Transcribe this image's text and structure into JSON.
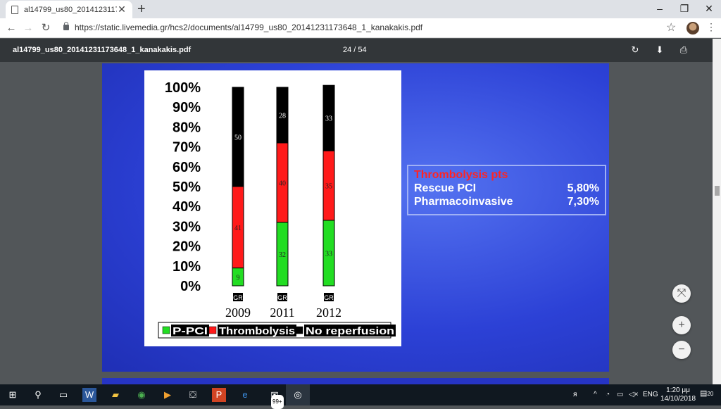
{
  "browser": {
    "tab_title": "al14799_us80_20141231173648_",
    "tab_close": "✕",
    "new_tab": "+",
    "minimize": "–",
    "restore": "❐",
    "close": "✕",
    "url": "https://static.livemedia.gr/hcs2/documents/al14799_us80_20141231173648_1_kanakakis.pdf"
  },
  "pdf": {
    "title": "al14799_us80_20141231173648_1_kanakakis.pdf",
    "page_indicator": "24 / 54"
  },
  "slide": {
    "info_title": "Thrombolysis pts",
    "rows": [
      {
        "label": "Rescue PCI",
        "value": "5,80%"
      },
      {
        "label": "Pharmacoinvasive",
        "value": "7,30%"
      }
    ]
  },
  "chart_data": {
    "type": "bar",
    "stacked": true,
    "categories": [
      "2009",
      "2011",
      "2012"
    ],
    "category_tags": [
      "GR",
      "GR",
      "GR"
    ],
    "series": [
      {
        "name": "P-PCI",
        "color": "#22dd22",
        "values": [
          9,
          32,
          33
        ]
      },
      {
        "name": "Thrombolysis",
        "color": "#ff1a1a",
        "values": [
          41,
          40,
          35
        ]
      },
      {
        "name": "No reperfusion",
        "color": "#000000",
        "values": [
          50,
          28,
          33
        ]
      }
    ],
    "y_ticks": [
      "100%",
      "90%",
      "80%",
      "70%",
      "60%",
      "50%",
      "40%",
      "30%",
      "20%",
      "10%",
      "0%"
    ],
    "ylim": [
      0,
      100
    ],
    "legend": "bottom"
  },
  "taskbar": {
    "lang": "ENG",
    "time": "1:20 μμ",
    "date": "14/10/2018",
    "notifications": "20",
    "badge": "99+"
  },
  "colors": {
    "slide_blue": "#2c41d6",
    "accent_red": "#ff2424"
  }
}
